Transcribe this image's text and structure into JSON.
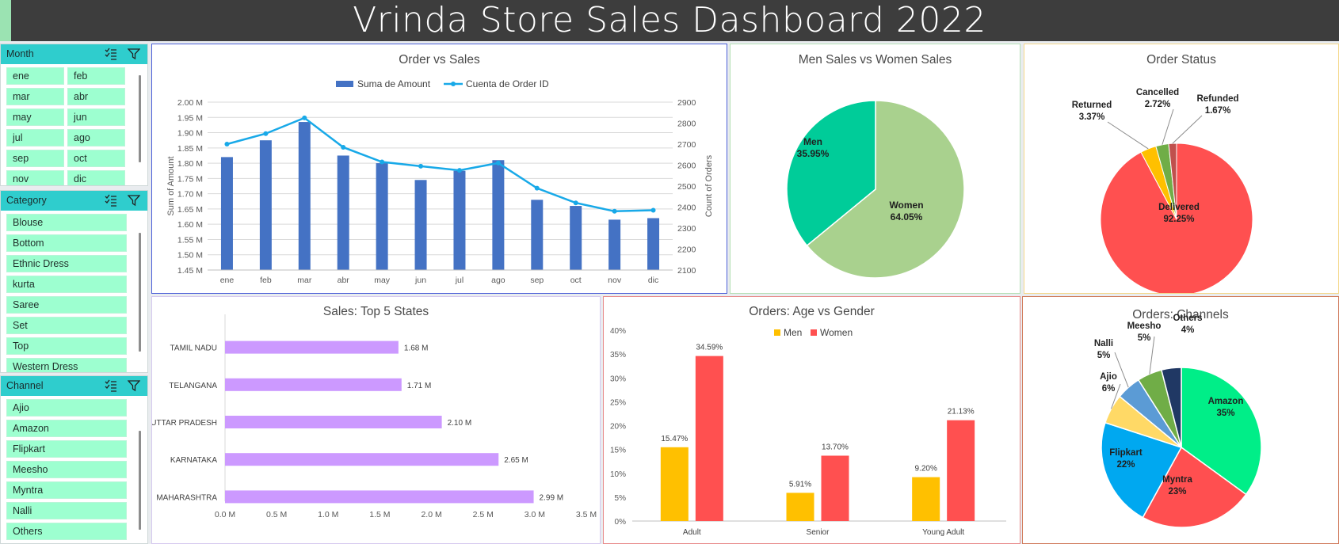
{
  "dashboard": {
    "title": "Vrinda Store Sales Dashboard 2022"
  },
  "slicers": {
    "month": {
      "label": "Month",
      "items": [
        "ene",
        "feb",
        "mar",
        "abr",
        "may",
        "jun",
        "jul",
        "ago",
        "sep",
        "oct",
        "nov",
        "dic"
      ]
    },
    "category": {
      "label": "Category",
      "items": [
        "Blouse",
        "Bottom",
        "Ethnic Dress",
        "kurta",
        "Saree",
        "Set",
        "Top",
        "Western Dress"
      ]
    },
    "channel": {
      "label": "Channel",
      "items": [
        "Ajio",
        "Amazon",
        "Flipkart",
        "Meesho",
        "Myntra",
        "Nalli",
        "Others"
      ]
    }
  },
  "charts": {
    "order_vs_sales": {
      "title": "Order vs Sales",
      "legend_bar": "Suma de Amount",
      "legend_line": "Cuenta de Order ID",
      "ylabel_left": "Sum of Amount",
      "ylabel_right": "Count of Orders",
      "left_ticks": [
        "1.45 M",
        "1.50 M",
        "1.55 M",
        "1.60 M",
        "1.65 M",
        "1.70 M",
        "1.75 M",
        "1.80 M",
        "1.85 M",
        "1.90 M",
        "1.95 M",
        "2.00 M"
      ],
      "right_ticks": [
        "2100",
        "2200",
        "2300",
        "2400",
        "2500",
        "2600",
        "2700",
        "2800",
        "2900"
      ]
    },
    "men_vs_women": {
      "title": "Men Sales vs Women Sales",
      "labels": [
        "Men",
        "Women"
      ],
      "values_text": [
        "35.95%",
        "64.05%"
      ]
    },
    "order_status": {
      "title": "Order Status",
      "labels": [
        "Delivered",
        "Returned",
        "Cancelled",
        "Refunded"
      ],
      "values_text": [
        "92.25%",
        "3.37%",
        "2.72%",
        "1.67%"
      ]
    },
    "top_states": {
      "title": "Sales: Top 5 States",
      "x_ticks": [
        "0.0 M",
        "0.5 M",
        "1.0 M",
        "1.5 M",
        "2.0 M",
        "2.5 M",
        "3.0 M",
        "3.5 M"
      ],
      "value_labels": [
        "1.68 M",
        "1.71 M",
        "2.10 M",
        "2.65 M",
        "2.99 M"
      ]
    },
    "age_gender": {
      "title": "Orders: Age vs Gender",
      "y_ticks": [
        "0%",
        "5%",
        "10%",
        "15%",
        "20%",
        "25%",
        "30%",
        "35%",
        "40%"
      ],
      "men_labels": [
        "15.47%",
        "5.91%",
        "9.20%"
      ],
      "women_labels": [
        "34.59%",
        "13.70%",
        "21.13%"
      ]
    },
    "channels": {
      "title": "Orders: Channels",
      "labels": [
        "Amazon",
        "Myntra",
        "Flipkart",
        "Ajio",
        "Nalli",
        "Meesho",
        "Others"
      ],
      "values_text": [
        "35%",
        "23%",
        "22%",
        "6%",
        "5%",
        "5%",
        "4%"
      ]
    }
  },
  "chart_data": [
    {
      "type": "bar",
      "title": "Order vs Sales",
      "categories": [
        "ene",
        "feb",
        "mar",
        "abr",
        "may",
        "jun",
        "jul",
        "ago",
        "sep",
        "oct",
        "nov",
        "dic"
      ],
      "series": [
        {
          "name": "Suma de Amount",
          "type": "bar",
          "axis": "left",
          "values": [
            1820000,
            1875000,
            1935000,
            1825000,
            1800000,
            1745000,
            1775000,
            1810000,
            1680000,
            1660000,
            1615000,
            1620000
          ]
        },
        {
          "name": "Cuenta de Order ID",
          "type": "line",
          "axis": "right",
          "values": [
            2700,
            2750,
            2825,
            2685,
            2615,
            2595,
            2575,
            2610,
            2490,
            2420,
            2380,
            2385
          ]
        }
      ],
      "xlabel": "",
      "ylabel": "Sum of Amount",
      "y2label": "Count of Orders",
      "ylim": [
        1450000,
        2000000
      ],
      "y2lim": [
        2100,
        2900
      ],
      "legend": "top",
      "grid": true,
      "colors": {
        "bar": "#4472c4",
        "line": "#18a9e8"
      }
    },
    {
      "type": "pie",
      "title": "Men Sales vs Women Sales",
      "labels": [
        "Men",
        "Women"
      ],
      "values": [
        35.95,
        64.05
      ],
      "colors": [
        "#00cc99",
        "#a9d18e"
      ]
    },
    {
      "type": "pie",
      "title": "Order Status",
      "labels": [
        "Delivered",
        "Returned",
        "Cancelled",
        "Refunded"
      ],
      "values": [
        92.25,
        3.37,
        2.72,
        1.67
      ],
      "colors": [
        "#ff5050",
        "#ffc000",
        "#70ad47",
        "#c0504d"
      ]
    },
    {
      "type": "bar",
      "orientation": "horizontal",
      "title": "Sales: Top 5 States",
      "categories": [
        "TAMIL NADU",
        "TELANGANA",
        "UTTAR PRADESH",
        "KARNATAKA",
        "MAHARASHTRA"
      ],
      "values": [
        1680000,
        1710000,
        2100000,
        2650000,
        2990000
      ],
      "xlim": [
        0,
        3500000
      ],
      "grid": false,
      "colors": {
        "bar": "#cc99ff"
      }
    },
    {
      "type": "bar",
      "title": "Orders: Age vs Gender",
      "categories": [
        "Adult",
        "Senior",
        "Young Adult"
      ],
      "series": [
        {
          "name": "Men",
          "values": [
            15.47,
            5.91,
            9.2
          ]
        },
        {
          "name": "Women",
          "values": [
            34.59,
            13.7,
            21.13
          ]
        }
      ],
      "ylim": [
        0,
        40
      ],
      "legend": "top",
      "grid": false,
      "colors": {
        "Men": "#ffc000",
        "Women": "#ff5050"
      }
    },
    {
      "type": "pie",
      "title": "Orders: Channels",
      "labels": [
        "Amazon",
        "Myntra",
        "Flipkart",
        "Ajio",
        "Nalli",
        "Meesho",
        "Others"
      ],
      "values": [
        35,
        23,
        22,
        6,
        5,
        5,
        4
      ],
      "colors": [
        "#00ee88",
        "#ff4f50",
        "#00a8f0",
        "#ffd966",
        "#5b9bd5",
        "#70ad47",
        "#203864"
      ]
    }
  ]
}
